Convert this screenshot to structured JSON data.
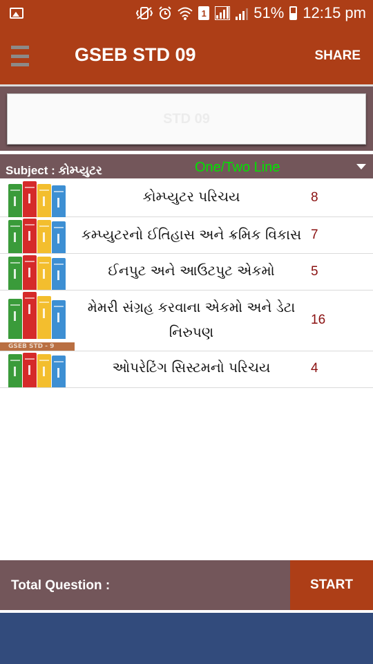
{
  "status_bar": {
    "battery": "51%",
    "time": "12:15 pm",
    "sim": "1"
  },
  "app_bar": {
    "title": "GSEB STD 09",
    "share_label": "SHARE"
  },
  "std_selector": {
    "value": "STD 09"
  },
  "subject_bar": {
    "subject_label": "Subject : કોમ્પ્યુટર",
    "line_mode": "One/Two Line"
  },
  "chapters": [
    {
      "title": "કોમ્પ્યુટર પરિચય",
      "count": "8"
    },
    {
      "title": "કમ્પ્યુટરનો ઈતિહાસ અને ક્રમિક વિકાસ",
      "count": "7"
    },
    {
      "title": "ઈનપુટ અને આઉટપુટ એકમો",
      "count": "5"
    },
    {
      "title": "મેમરી સંગ્રહ કરવાના એકમો અને ડેટા નિરુપણ",
      "count": "16",
      "shelf_label": "GSEB STD - 9"
    },
    {
      "title": "ઓપરેટિંગ સિસ્ટમનો પરિચય",
      "count": "4"
    }
  ],
  "footer": {
    "total_label": "Total Question :",
    "start_label": "START"
  },
  "colors": {
    "primary": "#ad3e17",
    "panel": "#73565a",
    "accent_green": "#00e400",
    "count_red": "#8a1010",
    "ad_blue": "#324b7c"
  }
}
